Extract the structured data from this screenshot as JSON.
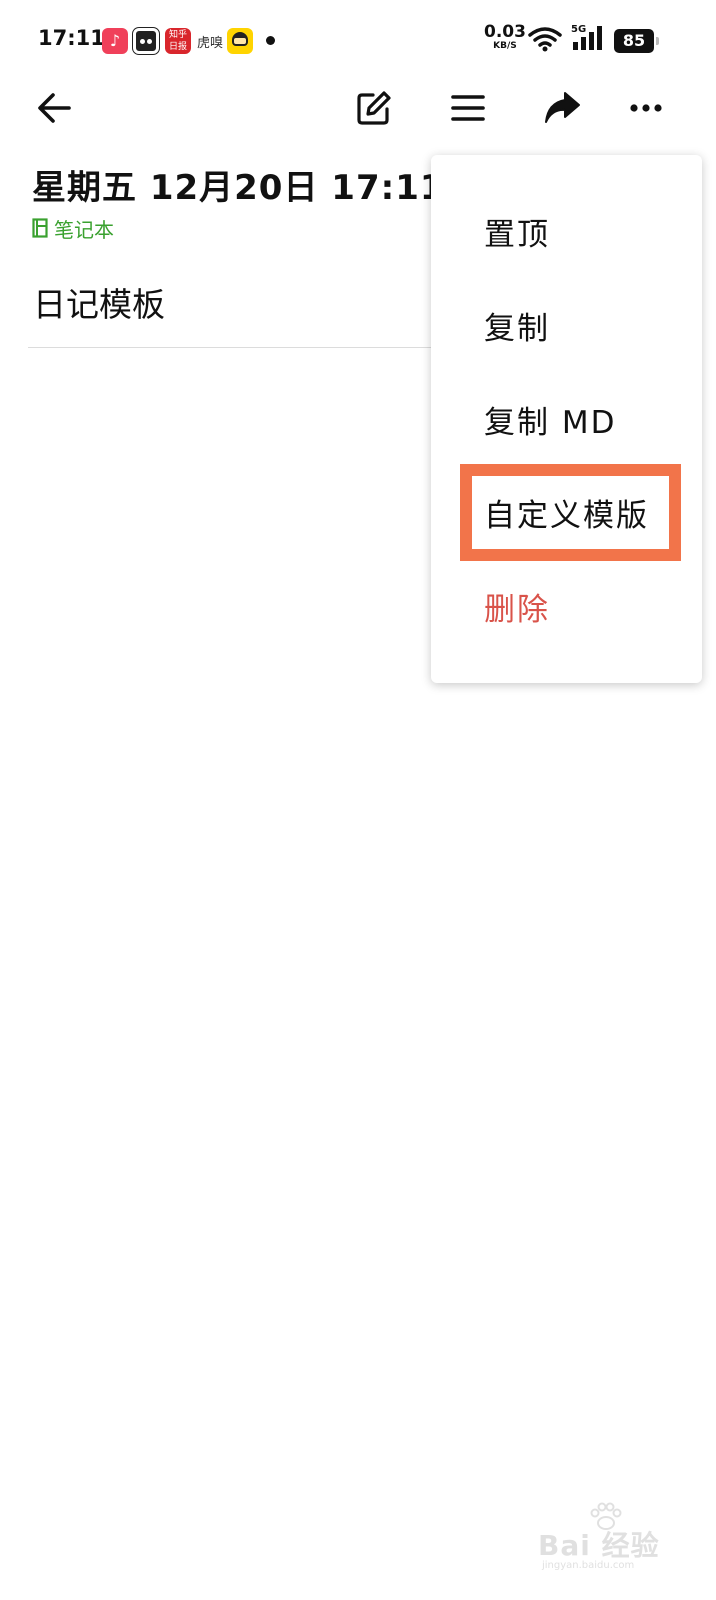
{
  "status_bar": {
    "time": "17:11",
    "text_app": "虎嗅",
    "red_app_text": "知乎 日报",
    "net_speed_value": "0.03",
    "net_speed_unit": "KB/S",
    "network_type": "5G",
    "battery_level": "85"
  },
  "toolbar": {
    "back_icon": "back-arrow-icon",
    "edit_icon": "edit-icon",
    "outline_icon": "menu-lines-icon",
    "share_icon": "share-icon",
    "more_icon": "more-icon"
  },
  "note": {
    "title": "星期五 12月20日 17:11",
    "notebook": "笔记本",
    "body": "日记模板"
  },
  "menu": {
    "items": [
      {
        "label": "置顶"
      },
      {
        "label": "复制"
      },
      {
        "label": "复制 MD"
      },
      {
        "label": "自定义模版"
      },
      {
        "label": "删除"
      }
    ],
    "highlighted_item": "自定义模版",
    "highlight_color": "#f2744a",
    "danger_color": "#d9534a"
  },
  "colors": {
    "notebook_green": "#3aa12f",
    "text": "#111111",
    "background": "#ffffff"
  },
  "watermark": {
    "logo": "Bai 经验",
    "site": "jingyan.baidu.com"
  }
}
